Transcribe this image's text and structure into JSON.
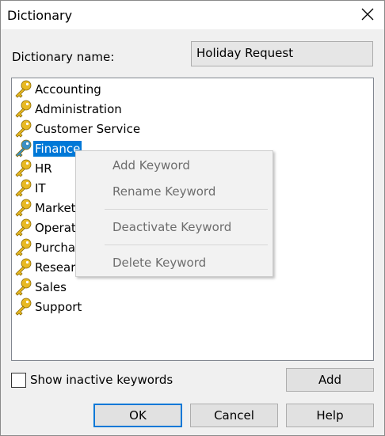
{
  "window": {
    "title": "Dictionary"
  },
  "dictionary": {
    "name_label": "Dictionary name:",
    "name_value": "Holiday Request"
  },
  "list": {
    "items": [
      {
        "label": "Accounting",
        "selected": false
      },
      {
        "label": "Administration",
        "selected": false
      },
      {
        "label": "Customer Service",
        "selected": false
      },
      {
        "label": "Finance",
        "selected": true
      },
      {
        "label": "HR",
        "selected": false
      },
      {
        "label": "IT",
        "selected": false
      },
      {
        "label": "Marketi",
        "selected": false
      },
      {
        "label": "Operati",
        "selected": false
      },
      {
        "label": "Purchas",
        "selected": false
      },
      {
        "label": "Researc",
        "selected": false
      },
      {
        "label": "Sales",
        "selected": false
      },
      {
        "label": "Support",
        "selected": false
      }
    ]
  },
  "context_menu": {
    "add": "Add Keyword",
    "rename": "Rename Keyword",
    "deactivate": "Deactivate Keyword",
    "delete": "Delete Keyword"
  },
  "options": {
    "show_inactive_label": "Show inactive keywords",
    "show_inactive_checked": false
  },
  "buttons": {
    "add": "Add",
    "ok": "OK",
    "cancel": "Cancel",
    "help": "Help"
  },
  "colors": {
    "selection": "#0078d7",
    "key_gold": "#e8b923",
    "key_selected": "#3a8fc4"
  },
  "icons": {
    "list_item": "key-icon",
    "close": "close-icon"
  }
}
